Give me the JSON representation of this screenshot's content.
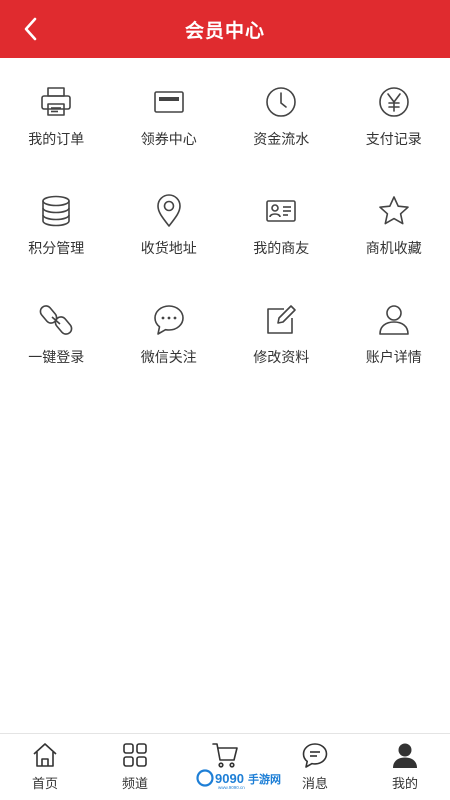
{
  "header": {
    "title": "会员中心",
    "back_icon": "chevron-left-icon",
    "background": "#e02b2f"
  },
  "menu": [
    {
      "label": "我的订单",
      "icon": "printer-icon"
    },
    {
      "label": "领券中心",
      "icon": "coupon-icon"
    },
    {
      "label": "资金流水",
      "icon": "clock-icon"
    },
    {
      "label": "支付记录",
      "icon": "yen-circle-icon"
    },
    {
      "label": "积分管理",
      "icon": "database-icon"
    },
    {
      "label": "收货地址",
      "icon": "location-pin-icon"
    },
    {
      "label": "我的商友",
      "icon": "id-card-icon"
    },
    {
      "label": "商机收藏",
      "icon": "star-icon"
    },
    {
      "label": "一键登录",
      "icon": "link-icon"
    },
    {
      "label": "微信关注",
      "icon": "chat-bubble-icon"
    },
    {
      "label": "修改资料",
      "icon": "edit-icon"
    },
    {
      "label": "账户详情",
      "icon": "user-icon"
    }
  ],
  "tabbar": [
    {
      "label": "首页",
      "icon": "home-icon"
    },
    {
      "label": "频道",
      "icon": "grid-icon"
    },
    {
      "label": "",
      "icon": "cart-icon"
    },
    {
      "label": "消息",
      "icon": "message-icon"
    },
    {
      "label": "我的",
      "icon": "profile-icon",
      "active": true
    }
  ],
  "watermark": {
    "text": "9090手游网",
    "url_text": "www.9090.cn"
  }
}
